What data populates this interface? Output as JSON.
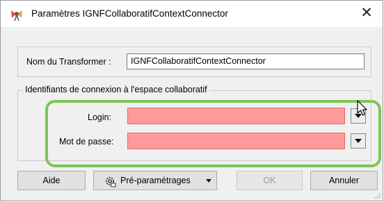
{
  "window": {
    "title": "Paramètres IGNFCollaboratifContextConnector",
    "close_symbol": "✕"
  },
  "transformer": {
    "label": "Nom du Transformer :",
    "value": "IGNFCollaboratifContextConnector"
  },
  "credentials": {
    "group_title": "Identifiants de connexion à l'espace collaboratif",
    "login_label": "Login:",
    "password_label": "Mot de passe:"
  },
  "buttons": {
    "help": "Aide",
    "presets": "Pré-paramétrages",
    "ok": "OK",
    "cancel": "Annuler"
  },
  "colors": {
    "required_field": "#ff9a9a",
    "highlight": "#7cc656",
    "background": "#f0f0f0"
  },
  "icons": [
    "app-icon",
    "close-icon",
    "dropdown-icon",
    "gear-icon",
    "mouse-cursor-icon",
    "resize-grip-icon"
  ]
}
